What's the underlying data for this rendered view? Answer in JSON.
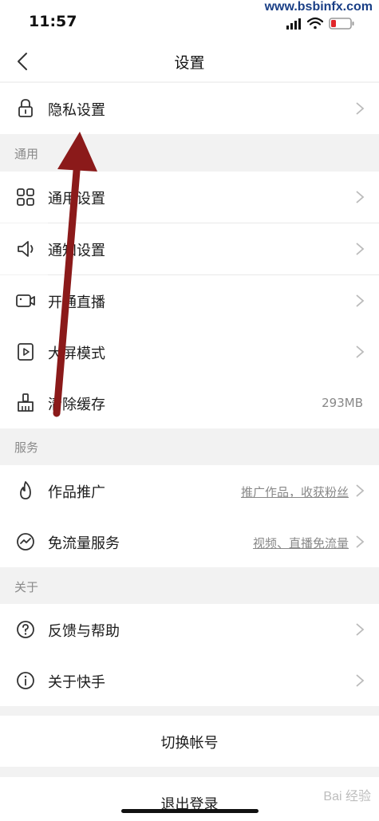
{
  "status": {
    "time": "11:57",
    "watermark_url": "www.bsbinfx.com"
  },
  "nav": {
    "title": "设置"
  },
  "rows": {
    "privacy": {
      "label": "隐私设置"
    },
    "general": {
      "label": "通用设置"
    },
    "notify": {
      "label": "通知设置"
    },
    "live": {
      "label": "开通直播"
    },
    "bigscreen": {
      "label": "大屏模式"
    },
    "cache": {
      "label": "清除缓存",
      "value": "293MB"
    },
    "promote": {
      "label": "作品推广",
      "link": "推广作品，收获粉丝"
    },
    "freeflow": {
      "label": "免流量服务",
      "link": "视频、直播免流量"
    },
    "feedback": {
      "label": "反馈与帮助"
    },
    "about": {
      "label": "关于快手"
    }
  },
  "sections": {
    "general": "通用",
    "services": "服务",
    "about": "关于"
  },
  "actions": {
    "switch_account": "切换帐号",
    "logout": "退出登录"
  },
  "watermark_bottom": "Bai 经验",
  "colors": {
    "background": "#f2f2f2",
    "row": "#ffffff",
    "arrow": "#8b1a1a"
  }
}
